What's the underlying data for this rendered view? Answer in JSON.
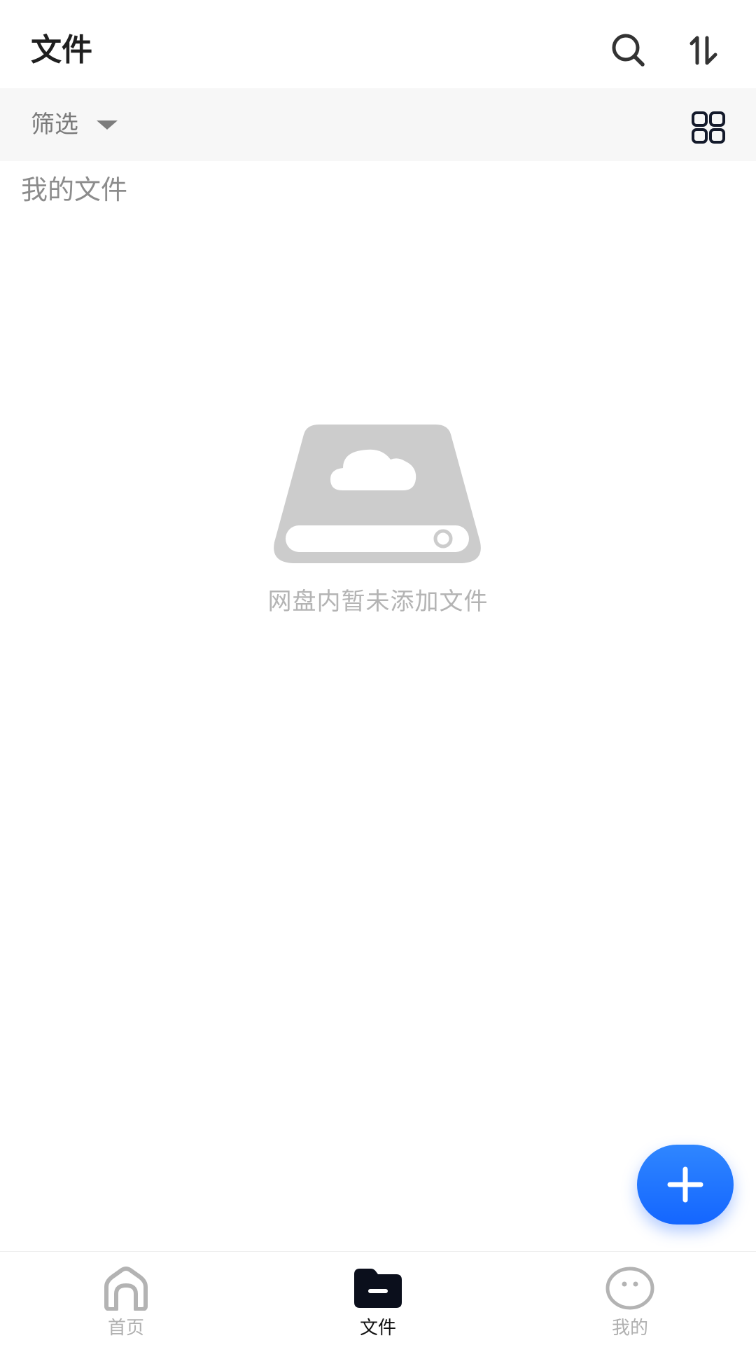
{
  "header": {
    "title": "文件",
    "search_icon": "search-icon",
    "sort_icon": "sort-icon"
  },
  "filter_bar": {
    "filter_label": "筛选",
    "caret_icon": "caret-down-icon",
    "view_icon": "grid-view-icon"
  },
  "section": {
    "title": "我的文件"
  },
  "empty_state": {
    "icon": "cloud-drive-icon",
    "message": "网盘内暂未添加文件"
  },
  "fab": {
    "icon": "plus-icon",
    "color": "#1a6dff"
  },
  "bottom_nav": {
    "items": [
      {
        "label": "首页",
        "icon": "home-icon",
        "active": false
      },
      {
        "label": "文件",
        "icon": "folder-icon",
        "active": true
      },
      {
        "label": "我的",
        "icon": "profile-face-icon",
        "active": false
      }
    ]
  },
  "colors": {
    "active_text": "#111111",
    "inactive_text": "#b0b0b0",
    "filter_bar_bg": "#f7f7f7",
    "empty_illustration": "#cccccc"
  }
}
